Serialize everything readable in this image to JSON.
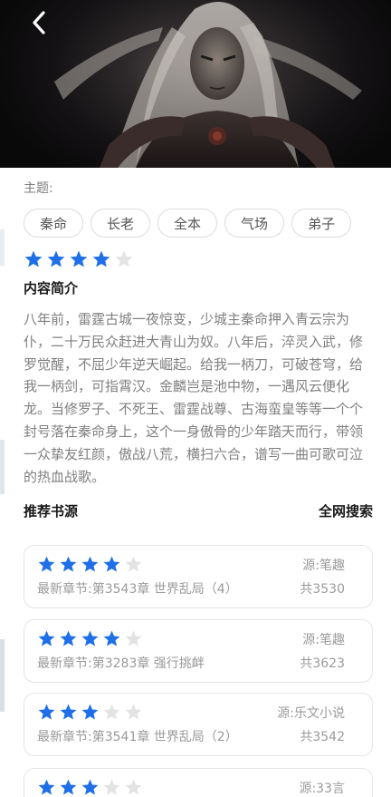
{
  "colors": {
    "accent": "#1e6fe8",
    "star_empty": "#e3e3e3",
    "muted_text": "#808080",
    "tag_border": "#dcdcdc"
  },
  "header": {
    "back_icon": "chevron-left-icon",
    "cover_image": "fantasy-warrior-portrait"
  },
  "theme": {
    "label": "主题:",
    "tags": [
      "秦命",
      "长老",
      "全本",
      "气场",
      "弟子"
    ]
  },
  "rating": 4,
  "rating_max": 5,
  "intro": {
    "title": "内容简介",
    "text": "八年前，雷霆古城一夜惊变，少城主秦命押入青云宗为仆，二十万民众赶进大青山为奴。八年后，淬灵入武，修罗觉醒，不屈少年逆天崛起。给我一柄刀，可破苍穹，给我一柄剑，可指霄汉。金麟岂是池中物，一遇风云便化龙。当修罗子、不死王、雷霆战尊、古海蛮皇等等一个个封号落在秦命身上，这个一身傲骨的少年踏天而行，带领一众挚友红颜，傲战八荒，横扫六合，谱写一曲可歌可泣的热血战歌。"
  },
  "sources_section": {
    "title": "推荐书源",
    "search_label": "全网搜索",
    "items": [
      {
        "rating": 4,
        "source": "源:笔趣",
        "chapter": "最新章节:第3543章 世界乱局（4）",
        "count": "共3530"
      },
      {
        "rating": 4,
        "source": "源:笔趣",
        "chapter": "最新章节:第3283章 强行挑衅",
        "count": "共3623"
      },
      {
        "rating": 3,
        "source": "源:乐文小说",
        "chapter": "最新章节:第3541章 世界乱局（2）",
        "count": "共3542"
      },
      {
        "rating": 3,
        "source": "源:33言",
        "chapter": "",
        "count": ""
      }
    ]
  }
}
